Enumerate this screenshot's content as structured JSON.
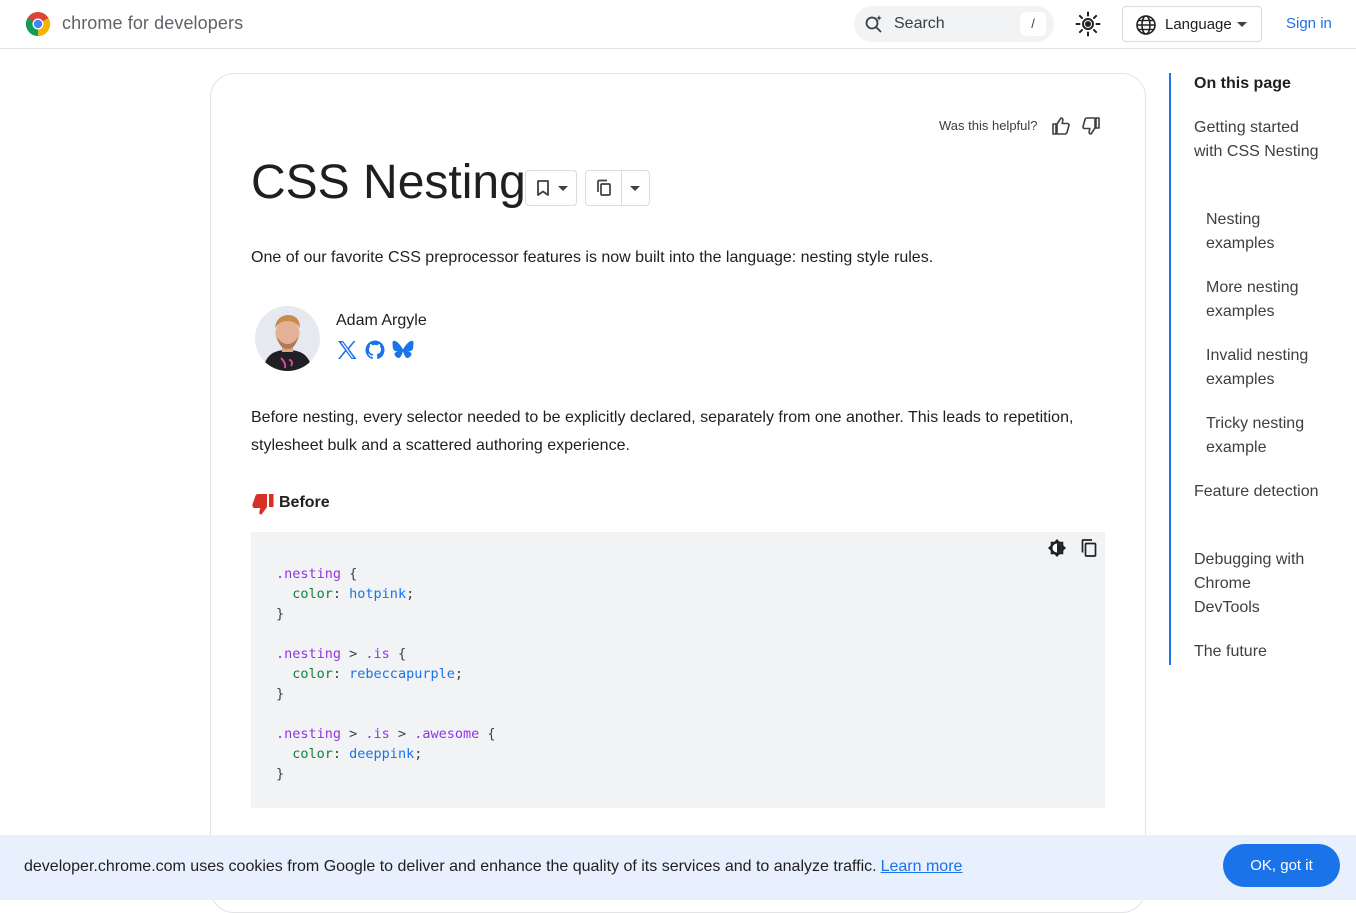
{
  "header": {
    "brand": "chrome for developers",
    "search_label": "Search",
    "search_shortcut": "/",
    "language_label": "Language",
    "signin_label": "Sign in",
    "logo_icon": "chrome-logo-icon",
    "theme_icon": "sun-icon"
  },
  "article": {
    "helpful_prompt": "Was this helpful?",
    "title": "CSS Nesting",
    "intro": "One of our favorite CSS preprocessor features is now built into the language: nesting style rules.",
    "author": {
      "name": "Adam Argyle",
      "socials": [
        "x-icon",
        "github-icon",
        "bluesky-icon"
      ]
    },
    "paragraph": "Before nesting, every selector needed to be explicitly declared, separately from one another. This leads to repetition, stylesheet bulk and a scattered authoring experience.",
    "before_label": "Before",
    "code_lines": [
      ".nesting {",
      "  color: hotpink;",
      "}",
      "",
      ".nesting > .is {",
      "  color: rebeccapurple;",
      "}",
      "",
      ".nesting > .is > .awesome {",
      "  color: deeppink;",
      "}"
    ]
  },
  "toc": {
    "heading": "On this page",
    "items": [
      {
        "label": "Getting started with CSS Nesting",
        "level": 1
      },
      {
        "label": "Nesting examples",
        "level": 2
      },
      {
        "label": "More nesting examples",
        "level": 2
      },
      {
        "label": "Invalid nesting examples",
        "level": 2
      },
      {
        "label": "Tricky nesting example",
        "level": 2
      },
      {
        "label": "Feature detection",
        "level": 1
      },
      {
        "label": "Debugging with Chrome DevTools",
        "level": 1
      },
      {
        "label": "The future",
        "level": 1
      }
    ]
  },
  "cookie": {
    "text": "developer.chrome.com uses cookies from Google to deliver and enhance the quality of its services and to analyze traffic.",
    "learn_more": "Learn more",
    "ok_label": "OK, got it"
  },
  "colors": {
    "accent": "#1a73e8",
    "thumb_down_red": "#d93025",
    "cookie_bg": "#e8f0fe"
  }
}
